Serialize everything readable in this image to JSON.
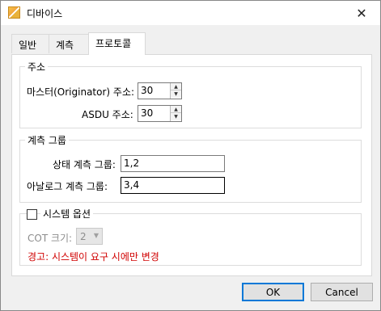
{
  "window": {
    "title": "디바이스",
    "close_glyph": "✕"
  },
  "tabs": [
    {
      "label": "일반",
      "active": false
    },
    {
      "label": "계측",
      "active": false
    },
    {
      "label": "프로토콜",
      "active": true
    }
  ],
  "address_group": {
    "title": "주소",
    "master_label": "마스터(Originator) 주소:",
    "master_value": "30",
    "asdu_label": "ASDU 주소:",
    "asdu_value": "30"
  },
  "measure_group": {
    "title": "계측 그룹",
    "status_label": "상태 계측 그룹:",
    "status_value": "1,2",
    "analog_label": "아날로그 계측 그룹:",
    "analog_value": "3,4"
  },
  "system_group": {
    "checkbox_label": "시스템 옵션",
    "checked": false,
    "cot_label": "COT 크기:",
    "cot_value": "2",
    "warning": "경고: 시스템이 요구 시에만 변경"
  },
  "buttons": {
    "ok": "OK",
    "cancel": "Cancel"
  }
}
